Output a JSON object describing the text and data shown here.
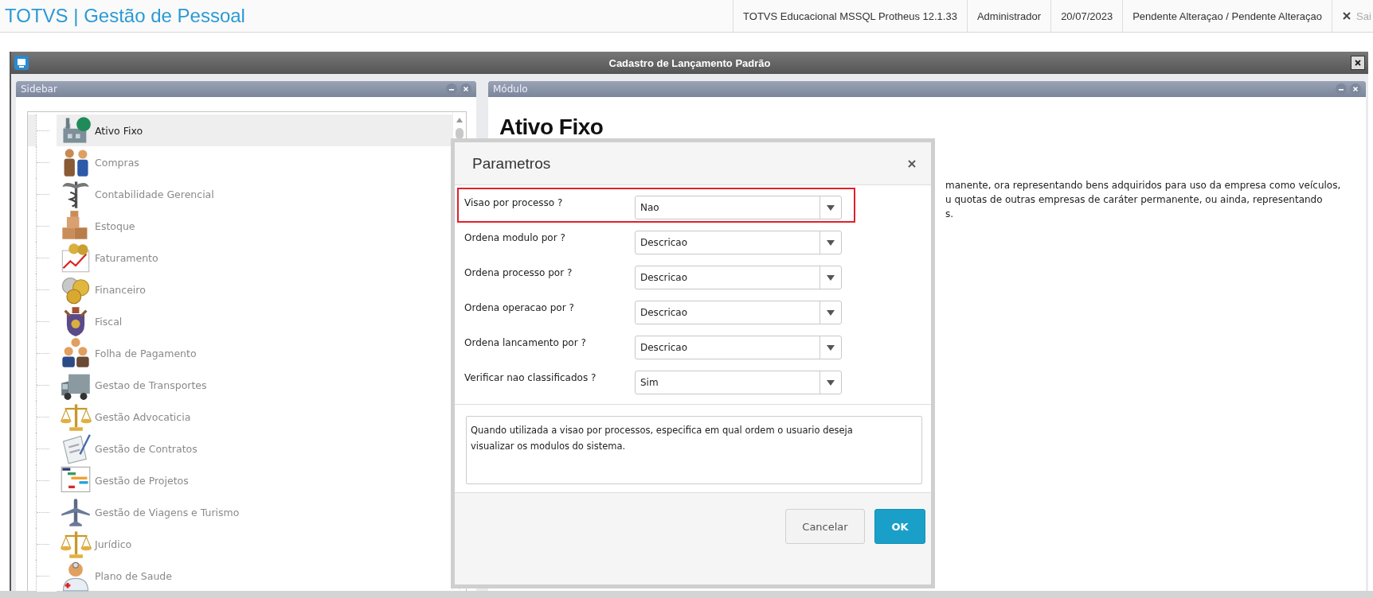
{
  "app": {
    "title": "TOTVS | Gestão de Pessoal"
  },
  "top_bar": {
    "items": [
      "TOTVS Educacional MSSQL Protheus 12.1.33",
      "Administrador",
      "20/07/2023",
      "Pendente Alteraçao / Pendente Alteraçao"
    ],
    "exit_label": "Sai"
  },
  "window": {
    "title": "Cadastro de Lançamento Padrão"
  },
  "sidebar": {
    "title": "Sidebar",
    "items": [
      {
        "label": "Ativo Fixo",
        "selected": true
      },
      {
        "label": "Compras",
        "selected": false
      },
      {
        "label": "Contabilidade Gerencial",
        "selected": false
      },
      {
        "label": "Estoque",
        "selected": false
      },
      {
        "label": "Faturamento",
        "selected": false
      },
      {
        "label": "Financeiro",
        "selected": false
      },
      {
        "label": "Fiscal",
        "selected": false
      },
      {
        "label": "Folha de Pagamento",
        "selected": false
      },
      {
        "label": "Gestao de Transportes",
        "selected": false
      },
      {
        "label": "Gestão Advocaticia",
        "selected": false
      },
      {
        "label": "Gestão de Contratos",
        "selected": false
      },
      {
        "label": "Gestão de Projetos",
        "selected": false
      },
      {
        "label": "Gestão de Viagens e Turismo",
        "selected": false
      },
      {
        "label": "Jurídico",
        "selected": false
      },
      {
        "label": "Plano de Saude",
        "selected": false
      }
    ]
  },
  "module": {
    "title": "Módulo",
    "heading": "Ativo Fixo",
    "description_lines": [
      "manente, ora representando bens adquiridos para uso da empresa como veículos,",
      "u quotas de outras empresas de caráter permanente, ou ainda, representando",
      "s."
    ]
  },
  "dialog": {
    "title": "Parametros",
    "parameters": [
      {
        "label": "Visao por processo ?",
        "value": "Nao",
        "highlighted": true
      },
      {
        "label": "Ordena modulo por ?",
        "value": "Descricao",
        "highlighted": false
      },
      {
        "label": "Ordena processo por ?",
        "value": "Descricao",
        "highlighted": false
      },
      {
        "label": "Ordena operacao por ?",
        "value": "Descricao",
        "highlighted": false
      },
      {
        "label": "Ordena lancamento por ?",
        "value": "Descricao",
        "highlighted": false
      },
      {
        "label": "Verificar nao classificados ?",
        "value": "Sim",
        "highlighted": false
      }
    ],
    "help_text": "Quando utilizada a visao por processos, especifica em qual ordem o usuario deseja visualizar os modulos do sistema.",
    "buttons": [
      {
        "label": "Cancelar",
        "kind": "secondary"
      },
      {
        "label": "OK",
        "kind": "primary"
      }
    ]
  }
}
